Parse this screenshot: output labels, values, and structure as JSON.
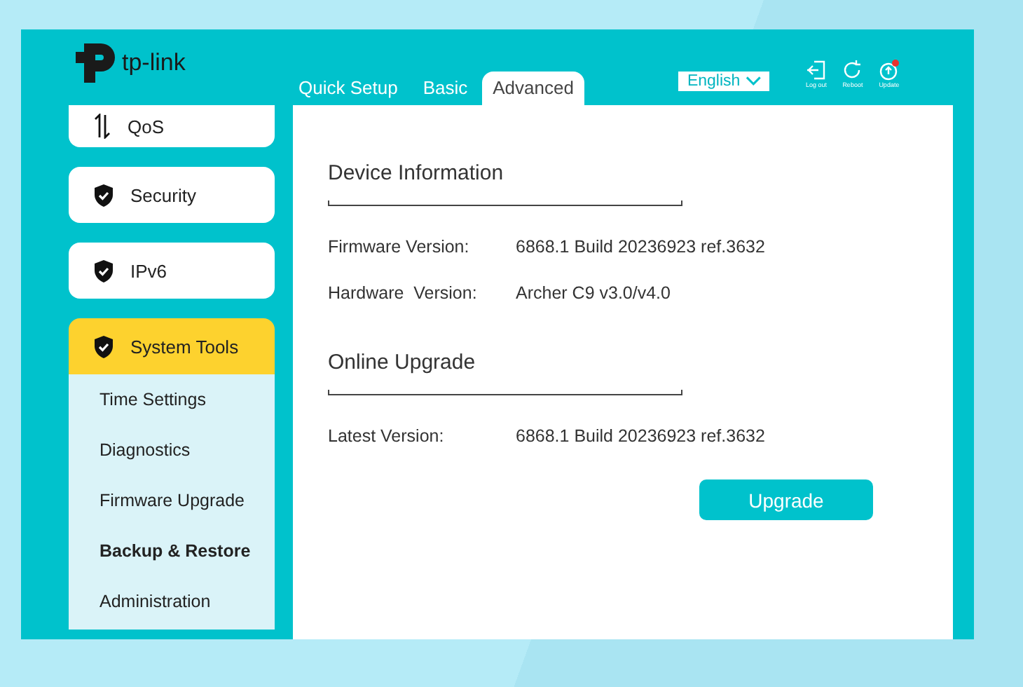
{
  "header": {
    "logo_text": "tp-link",
    "tabs": [
      {
        "label": "Quick Setup",
        "selected": false
      },
      {
        "label": "Basic",
        "selected": false
      },
      {
        "label": "Advanced",
        "selected": true
      }
    ],
    "language": "English",
    "actions": [
      {
        "kind": "logout",
        "label": "Log out",
        "notification": false
      },
      {
        "kind": "reboot",
        "label": "Reboot",
        "notification": false
      },
      {
        "kind": "update",
        "label": "Update",
        "notification": true
      }
    ]
  },
  "sidebar": {
    "items": [
      {
        "label": "QoS",
        "kind": "arrows",
        "selected": false
      },
      {
        "label": "Security",
        "kind": "shield",
        "selected": false
      },
      {
        "label": "IPv6",
        "kind": "shield",
        "selected": false
      },
      {
        "label": "System Tools",
        "kind": "shield",
        "selected": true,
        "children": [
          {
            "label": "Time Settings",
            "selected": false
          },
          {
            "label": "Diagnostics",
            "selected": false
          },
          {
            "label": "Firmware Upgrade",
            "selected": false
          },
          {
            "label": "Backup & Restore",
            "selected": true
          },
          {
            "label": "Administration",
            "selected": false
          }
        ]
      }
    ]
  },
  "content": {
    "sections": [
      {
        "title": "Device Information",
        "rows": [
          {
            "label": "Firmware Version:",
            "value": "6868.1 Build 20236923 ref.3632"
          },
          {
            "label": "Hardware  Version:",
            "value": "Archer C9 v3.0/v4.0"
          }
        ]
      },
      {
        "title": "Online Upgrade",
        "rows": [
          {
            "label": "Latest Version:",
            "value": "6868.1 Build 20236923 ref.3632"
          }
        ]
      }
    ],
    "button": "Upgrade"
  }
}
